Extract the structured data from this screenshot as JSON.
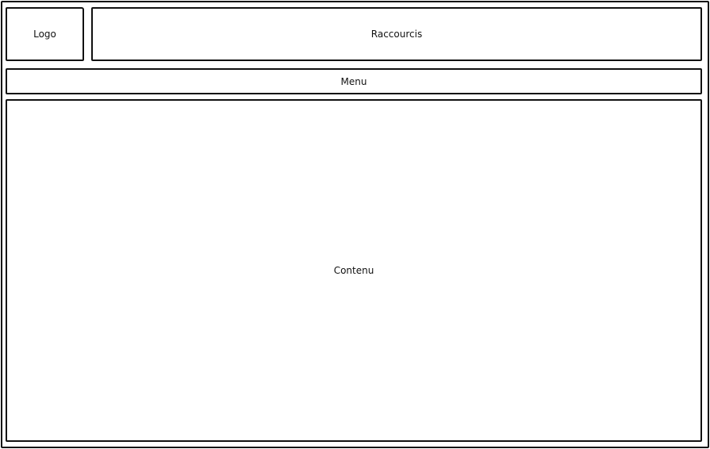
{
  "header": {
    "logo_label": "Logo",
    "shortcuts_label": "Raccourcis"
  },
  "nav": {
    "menu_label": "Menu"
  },
  "main": {
    "content_label": "Contenu"
  }
}
